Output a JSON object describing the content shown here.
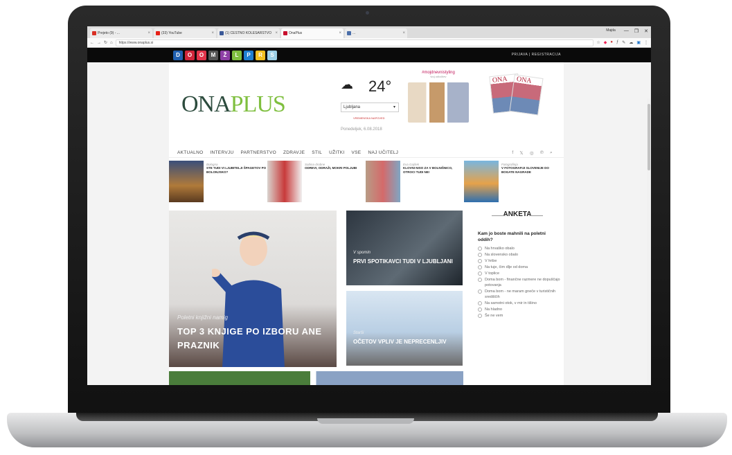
{
  "browser": {
    "tabs": [
      {
        "label": "Prejeto (9) - ...",
        "favicon_color": "#d93025",
        "active": false
      },
      {
        "label": "(33) YouTube",
        "favicon_color": "#e62117",
        "active": false
      },
      {
        "label": "(1) CESTNO KOLESARSTVO",
        "favicon_color": "#3b5998",
        "active": false
      },
      {
        "label": "OnaPlus",
        "favicon_color": "#c8102e",
        "active": true
      },
      {
        "label": "...",
        "favicon_color": "#4a6ea9",
        "active": false
      }
    ],
    "window_user": "Majda",
    "window_controls": [
      "—",
      "❐",
      "✕"
    ],
    "url": "https://www.onaplus.si"
  },
  "topbar": {
    "site_icons": [
      {
        "letter": "D",
        "color": "#2060b0"
      },
      {
        "letter": "O",
        "color": "#d0253a"
      },
      {
        "letter": "O",
        "color": "#e2344a"
      },
      {
        "letter": "M",
        "color": "#555555"
      },
      {
        "letter": "Ž",
        "color": "#8e3fa6"
      },
      {
        "letter": "L",
        "color": "#7fbf3f"
      },
      {
        "letter": "P",
        "color": "#1f7fd0"
      },
      {
        "letter": "R",
        "color": "#f0c020"
      },
      {
        "letter": "S",
        "color": "#9ed0e6"
      }
    ],
    "login": "PRIJAVA",
    "register": "REGISTRACIJA"
  },
  "header": {
    "logo_ona": "ONA",
    "logo_plus": "PLUS",
    "weather_icon": "cloud-icon",
    "temperature": "24°",
    "city": "Ljubljana",
    "weather_link": "VREMENSKA NAPOVED",
    "date": "Ponedeljek, 6.08.2018",
    "promo_title": "#mojdnevnistyling",
    "promo_sub": "tvoj odločitev",
    "mag1": "ONA",
    "mag2": "ONA"
  },
  "mainnav": {
    "items": [
      "AKTUALNO",
      "INTERVJU",
      "PARTNERSTVO",
      "ZDRAVJE",
      "STIL",
      "UŽITKI",
      "VSE",
      "NAJ UČITELJ"
    ],
    "social": [
      "f",
      "𝕏",
      "◎",
      "℗",
      "⌕"
    ]
  },
  "newsrow": [
    {
      "category": "Bologna",
      "title": "STE TUDI VI LJUBITELJI ŠPAGETOV PO BOLONJSKO?"
    },
    {
      "category": "Sabina drobne",
      "title": "ODREVI, ODRAŽI, MOKRI POLJUBI"
    },
    {
      "category": "Eva Gajšek",
      "title": "KLOVNI NISO ZA V BOLNIŠNICO, OTROCI TUDI NE!"
    },
    {
      "category": "Fotografinja",
      "title": "V FOTOGRAFIJI SLOVENIJE DO BOGATE NAGRADE"
    }
  ],
  "hero": {
    "category": "Poletni knjižni namig",
    "title": "TOP 3 KNJIGE PO IZBORU ANE PRAZNIK"
  },
  "cards": [
    {
      "category": "V spomin",
      "title": "PRVI SPOTIKAVCI TUDI V LJUBLJANI"
    },
    {
      "category": "Starši",
      "title": "OČETOV VPLIV JE NEPRECENLJIV"
    }
  ],
  "poll": {
    "heading": "ANKETA",
    "question": "Kam jo boste mahnili na poletni oddih?",
    "options": [
      "Na hrvaško obalo",
      "Na slovensko obalo",
      "V hribe",
      "Na tuje, čim dlje od doma",
      "V toplice",
      "Doma bom - finančne razmere ne dopuščajo potovanja",
      "Doma bom - ne maram gneče v turističnih središčih",
      "Na samotni otok, v mir in tišino",
      "Na hladno",
      "Še ne vem"
    ]
  }
}
